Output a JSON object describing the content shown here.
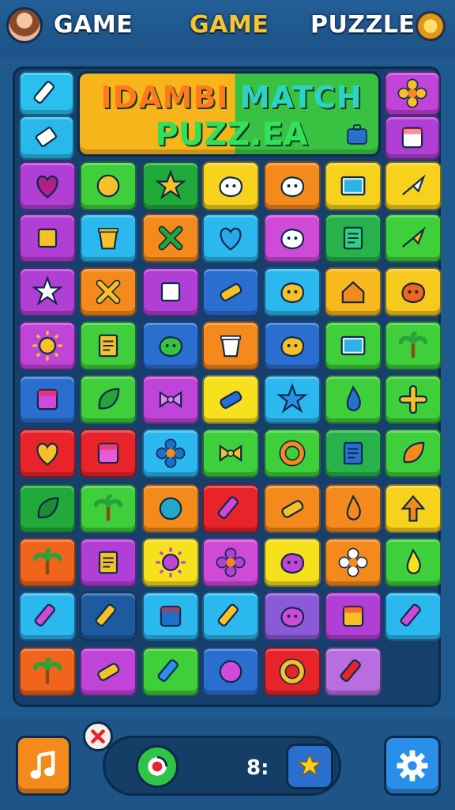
{
  "header": {
    "left_title": "GAME",
    "center_title": "GAME",
    "right_title": "PUZZLE",
    "center_color": "#f5c431"
  },
  "banner": {
    "line1_a": "IDAMBI",
    "line1_b": "MATCH",
    "line2": "PUZZ.EA"
  },
  "footer": {
    "score": "8:"
  },
  "tiles": [
    {
      "c": "#29c0ee",
      "i": "pencil",
      "ic": "#ffffff"
    },
    {
      "c": "#c044d8",
      "i": "flower",
      "ic": "#f7c028"
    },
    {
      "c": "#28b9ea",
      "i": "eraser",
      "ic": "#ffffff"
    },
    {
      "c": "#b13fd6",
      "i": "box",
      "ic": "#ffffff"
    },
    {
      "c": "#b13fd6",
      "i": "heart",
      "ic": "#b01e88"
    },
    {
      "c": "#3fcf3a",
      "i": "circle",
      "ic": "#f7c028"
    },
    {
      "c": "#21a93a",
      "i": "star",
      "ic": "#f7c028"
    },
    {
      "c": "#f8d21c",
      "i": "blob",
      "ic": "#ffffff"
    },
    {
      "c": "#f58a1c",
      "i": "blob",
      "ic": "#ffffff"
    },
    {
      "c": "#f7d21c",
      "i": "screen",
      "ic": "#2bb3e8"
    },
    {
      "c": "#f7d21c",
      "i": "arrow",
      "ic": "#ffffff"
    },
    {
      "c": "#b13fd6",
      "i": "square",
      "ic": "#f7c028"
    },
    {
      "c": "#2bb8ee",
      "i": "cup",
      "ic": "#f7c028"
    },
    {
      "c": "#f58a1c",
      "i": "cross",
      "ic": "#27a33a"
    },
    {
      "c": "#2bb8ee",
      "i": "heart",
      "ic": "#29a8ea"
    },
    {
      "c": "#d04ad8",
      "i": "blob",
      "ic": "#ffffff"
    },
    {
      "c": "#27b34a",
      "i": "note",
      "ic": "#2fd37a"
    },
    {
      "c": "#3fcf3a",
      "i": "arrow",
      "ic": "#f7c028"
    },
    {
      "c": "#b13fd6",
      "i": "star",
      "ic": "#ffffff"
    },
    {
      "c": "#f58a1c",
      "i": "cross",
      "ic": "#f7c028"
    },
    {
      "c": "#b13fd6",
      "i": "square",
      "ic": "#ffffff"
    },
    {
      "c": "#2a6fd0",
      "i": "bar",
      "ic": "#f7c028"
    },
    {
      "c": "#2bb8ee",
      "i": "blob",
      "ic": "#f7c028"
    },
    {
      "c": "#f7b91c",
      "i": "house",
      "ic": "#f58a1c"
    },
    {
      "c": "#f7c91c",
      "i": "blob",
      "ic": "#f0641c"
    },
    {
      "c": "#c044d8",
      "i": "sun",
      "ic": "#f7c028"
    },
    {
      "c": "#3fcf3a",
      "i": "note",
      "ic": "#f7c028"
    },
    {
      "c": "#2a6fd0",
      "i": "blob",
      "ic": "#39c241"
    },
    {
      "c": "#f58a1c",
      "i": "cup",
      "ic": "#ffffff"
    },
    {
      "c": "#2a6fd0",
      "i": "blob",
      "ic": "#f7c028"
    },
    {
      "c": "#3fcf3a",
      "i": "screen",
      "ic": "#2bb3e8"
    },
    {
      "c": "#3fcf3a",
      "i": "palm",
      "ic": "#27a33a"
    },
    {
      "c": "#2a6fd0",
      "i": "box",
      "ic": "#d04ad8"
    },
    {
      "c": "#3fcf3a",
      "i": "leaf",
      "ic": "#27a33a"
    },
    {
      "c": "#c044d8",
      "i": "bow",
      "ic": "#e688e8"
    },
    {
      "c": "#f7e11c",
      "i": "bar",
      "ic": "#2a6fd0"
    },
    {
      "c": "#2bb8ee",
      "i": "star",
      "ic": "#2a8fe8"
    },
    {
      "c": "#3fcf3a",
      "i": "drop",
      "ic": "#2a6fd0"
    },
    {
      "c": "#3fcf3a",
      "i": "plus",
      "ic": "#f7c028"
    },
    {
      "c": "#e8242a",
      "i": "heart",
      "ic": "#f7c028"
    },
    {
      "c": "#e8242a",
      "i": "box",
      "ic": "#ea5ad8"
    },
    {
      "c": "#2bb8ee",
      "i": "flower",
      "ic": "#1d70c8"
    },
    {
      "c": "#3fcf3a",
      "i": "bow",
      "ic": "#f7c028"
    },
    {
      "c": "#3fcf3a",
      "i": "ring",
      "ic": "#f58a1c"
    },
    {
      "c": "#27b34a",
      "i": "note",
      "ic": "#2a6fd0"
    },
    {
      "c": "#3fcf3a",
      "i": "leaf",
      "ic": "#f58a1c"
    },
    {
      "c": "#21a93a",
      "i": "leaf",
      "ic": "#1f8a35"
    },
    {
      "c": "#3fcf3a",
      "i": "palm",
      "ic": "#27a33a"
    },
    {
      "c": "#f58a1c",
      "i": "circle",
      "ic": "#23a8c8"
    },
    {
      "c": "#e8242a",
      "i": "pencil",
      "ic": "#d04ad8"
    },
    {
      "c": "#f58a1c",
      "i": "bar",
      "ic": "#f7c028"
    },
    {
      "c": "#f58a1c",
      "i": "drop",
      "ic": "#f58a1c"
    },
    {
      "c": "#f7d21c",
      "i": "arrowup",
      "ic": "#f58a1c"
    },
    {
      "c": "#f0641c",
      "i": "palm",
      "ic": "#27a33a"
    },
    {
      "c": "#b13fd6",
      "i": "note",
      "ic": "#f7c028"
    },
    {
      "c": "#f7e11c",
      "i": "sun",
      "ic": "#c044d8"
    },
    {
      "c": "#d04ad8",
      "i": "flower",
      "ic": "#b13fd6"
    },
    {
      "c": "#f7e11c",
      "i": "blob",
      "ic": "#c044d8"
    },
    {
      "c": "#f58a1c",
      "i": "flower",
      "ic": "#ffffff"
    },
    {
      "c": "#3fcf3a",
      "i": "drop",
      "ic": "#f7e11c"
    },
    {
      "c": "#2bb8ee",
      "i": "pencil",
      "ic": "#d04ad8"
    },
    {
      "c": "#1d5aa0",
      "i": "pencil",
      "ic": "#f7c028"
    },
    {
      "c": "#2bb8ee",
      "i": "box",
      "ic": "#1d70c8"
    },
    {
      "c": "#2bb8ee",
      "i": "pencil",
      "ic": "#f7c028"
    },
    {
      "c": "#8a5ad8",
      "i": "blob",
      "ic": "#d04ad8"
    },
    {
      "c": "#b13fd6",
      "i": "box",
      "ic": "#f7c028"
    },
    {
      "c": "#2bb8ee",
      "i": "pencil",
      "ic": "#d04ad8"
    },
    {
      "c": "#f0641c",
      "i": "palm",
      "ic": "#27a33a"
    },
    {
      "c": "#c044d8",
      "i": "bar",
      "ic": "#f7c028"
    },
    {
      "c": "#3fcf3a",
      "i": "pencil",
      "ic": "#2a8fe8"
    },
    {
      "c": "#2a6fd0",
      "i": "circle",
      "ic": "#d04ad8"
    },
    {
      "c": "#e8242a",
      "i": "ring",
      "ic": "#f7c028"
    },
    {
      "c": "#b96ee0",
      "i": "pencil",
      "ic": "#e8242a"
    }
  ]
}
